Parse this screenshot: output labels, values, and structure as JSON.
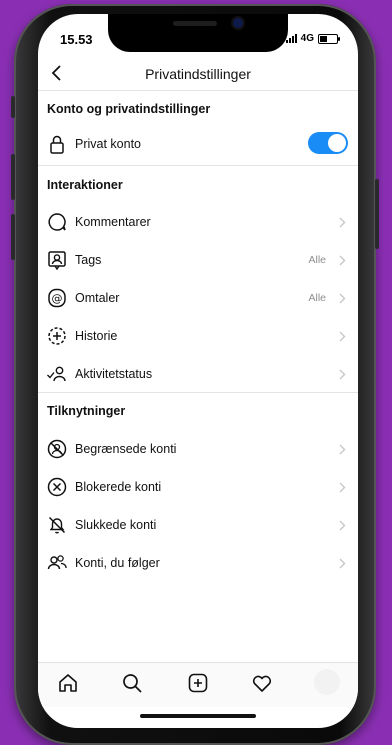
{
  "status_bar": {
    "time": "15.53",
    "network": "4G"
  },
  "header": {
    "title": "Privatindstillinger"
  },
  "sections": {
    "account": {
      "title": "Konto og privatindstillinger",
      "private_label": "Privat konto",
      "private_on": true
    },
    "interactions": {
      "title": "Interaktioner",
      "items": [
        {
          "label": "Kommentarer",
          "value": ""
        },
        {
          "label": "Tags",
          "value": "Alle"
        },
        {
          "label": "Omtaler",
          "value": "Alle"
        },
        {
          "label": "Historie",
          "value": ""
        },
        {
          "label": "Aktivitetstatus",
          "value": ""
        }
      ]
    },
    "connections": {
      "title": "Tilknytninger",
      "items": [
        {
          "label": "Begrænsede konti"
        },
        {
          "label": "Blokerede konti"
        },
        {
          "label": "Slukkede konti"
        },
        {
          "label": "Konti, du følger"
        }
      ]
    }
  },
  "colors": {
    "accent": "#1a8cf5",
    "background": "#8a2fb3"
  }
}
